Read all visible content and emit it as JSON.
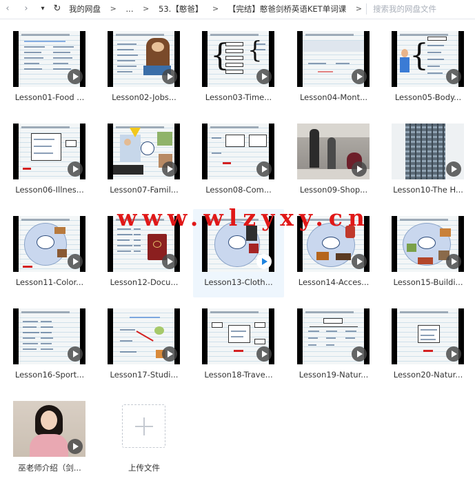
{
  "nav": {
    "back_glyph": "‹",
    "forward_glyph": "›",
    "dropdown_glyph": "▾",
    "refresh_glyph": "↻"
  },
  "breadcrumb": {
    "items": [
      "我的网盘",
      "...",
      "53.【憨爸】",
      "【完结】憨爸剑桥英语KET单词课"
    ],
    "separator": ">"
  },
  "search": {
    "placeholder": "搜索我的网盘文件"
  },
  "files": [
    {
      "name": "Lesson01-Food ..."
    },
    {
      "name": "Lesson02-Jobs..."
    },
    {
      "name": "Lesson03-Time..."
    },
    {
      "name": "Lesson04-Mont..."
    },
    {
      "name": "Lesson05-Body..."
    },
    {
      "name": "Lesson06-Illnes..."
    },
    {
      "name": "Lesson07-Famil..."
    },
    {
      "name": "Lesson08-Com..."
    },
    {
      "name": "Lesson09-Shop..."
    },
    {
      "name": "Lesson10-The H..."
    },
    {
      "name": "Lesson11-Color..."
    },
    {
      "name": "Lesson12-Docu..."
    },
    {
      "name": "Lesson13-Cloth..."
    },
    {
      "name": "Lesson14-Acces..."
    },
    {
      "name": "Lesson15-Buildi..."
    },
    {
      "name": "Lesson16-Sport..."
    },
    {
      "name": "Lesson17-Studi..."
    },
    {
      "name": "Lesson18-Trave..."
    },
    {
      "name": "Lesson19-Natur..."
    },
    {
      "name": "Lesson20-Natur..."
    },
    {
      "name": "巫老师介绍（剑..."
    }
  ],
  "selected_file": "Lesson13-Cloth...",
  "upload": {
    "label": "上传文件"
  },
  "watermark": {
    "text": "www.wlzyxy.cn"
  },
  "colors": {
    "accent": "#1f84e0",
    "selected_bg": "#eef6fd",
    "watermark": "#e01818"
  }
}
